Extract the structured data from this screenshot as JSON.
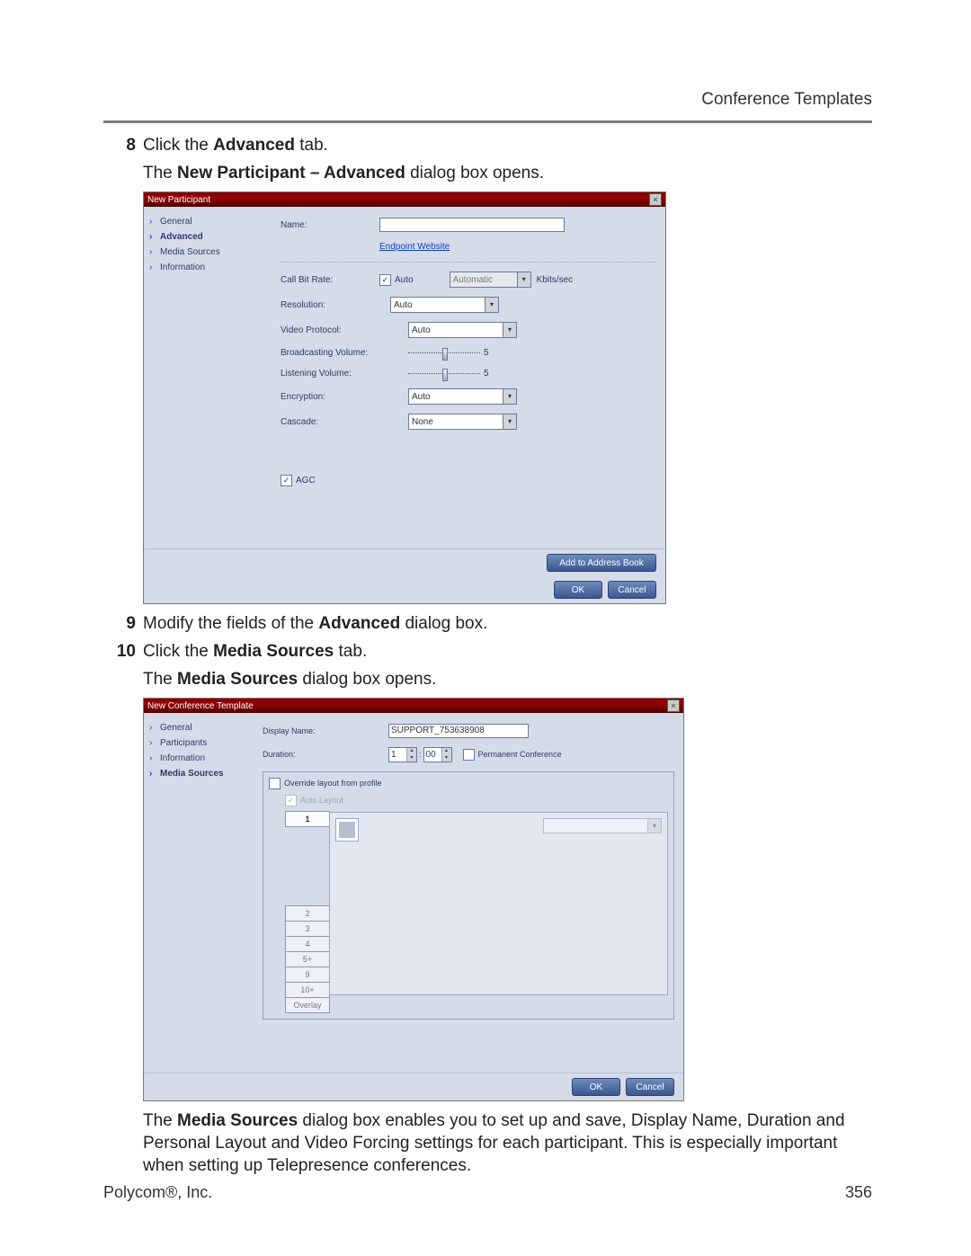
{
  "header": {
    "title": "Conference Templates"
  },
  "steps": {
    "s8": {
      "num": "8",
      "pre": "Click the ",
      "bold": "Advanced",
      "post": " tab."
    },
    "s8b": {
      "pre": "The ",
      "bold": "New Participant – Advanced",
      "post": " dialog box opens."
    },
    "s9": {
      "num": "9",
      "pre": "Modify the fields of the ",
      "bold": "Advanced",
      "post": " dialog box."
    },
    "s10": {
      "num": "10",
      "pre": "Click the ",
      "bold": "Media Sources",
      "post": " tab."
    },
    "s10b": {
      "pre": "The ",
      "bold": "Media Sources",
      "post": " dialog box opens."
    },
    "paragraph": {
      "pre": "The ",
      "bold": "Media Sources",
      "post": " dialog box enables you to set up and save, Display Name, Duration and Personal Layout and Video Forcing settings for each participant. This is especially important when setting up Telepresence conferences."
    }
  },
  "dlg1": {
    "title": "New Participant",
    "close": "×",
    "sidebar": [
      "General",
      "Advanced",
      "Media Sources",
      "Information"
    ],
    "selected": "Advanced",
    "labels": {
      "name": "Name:",
      "endpoint": "Endpoint Website",
      "cbr": "Call Bit Rate:",
      "auto": "Auto",
      "cbr_value": "Automatic",
      "kbits": "Kbits/sec",
      "resolution": "Resolution:",
      "resolution_value": "Auto",
      "vprotocol": "Video Protocol:",
      "vprotocol_value": "Auto",
      "bvol": "Broadcasting Volume:",
      "bvol_value": "5",
      "lvol": "Listening Volume:",
      "lvol_value": "5",
      "encryption": "Encryption:",
      "encryption_value": "Auto",
      "cascade": "Cascade:",
      "cascade_value": "None",
      "agc": "AGC"
    },
    "footer": {
      "addr": "Add to Address Book",
      "ok": "OK",
      "cancel": "Cancel"
    }
  },
  "dlg2": {
    "title": "New Conference Template",
    "close": "×",
    "sidebar": [
      "General",
      "Participants",
      "Information",
      "Media Sources"
    ],
    "selected": "Media Sources",
    "labels": {
      "display_name": "Display Name:",
      "display_name_value": "SUPPORT_753638908",
      "duration": "Duration:",
      "duration_h": "1",
      "duration_m": "00",
      "sep": ":",
      "permanent": "Permanent Conference",
      "override": "Override layout from profile",
      "autolayout": "Auto Layout"
    },
    "tabs": [
      "1",
      "2",
      "3",
      "4",
      "5+",
      "9",
      "10+",
      "Overlay"
    ],
    "active_tab": "1",
    "footer": {
      "ok": "OK",
      "cancel": "Cancel"
    }
  },
  "footer": {
    "left": "Polycom®, Inc.",
    "right": "356"
  }
}
